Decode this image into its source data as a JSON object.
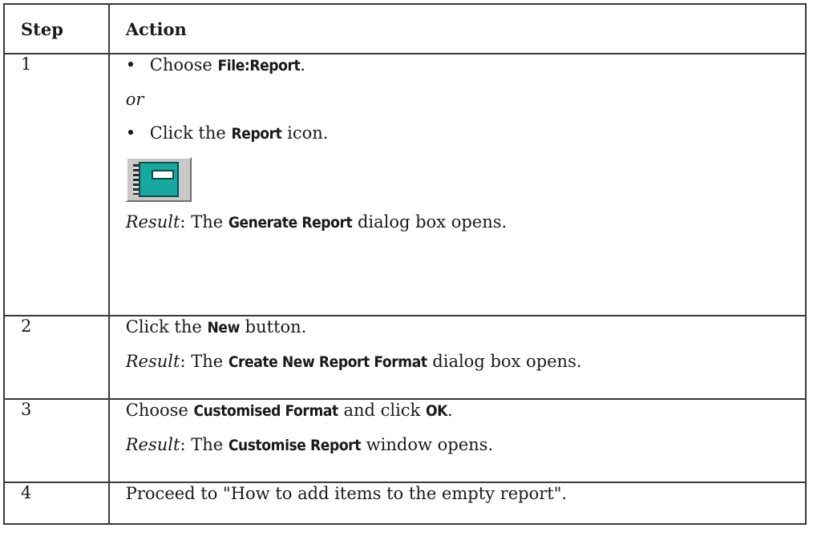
{
  "table": {
    "headers": {
      "step": "Step",
      "action": "Action"
    },
    "rows": [
      {
        "step": "1",
        "line1": {
          "pre": "Choose ",
          "ui": "File:Report",
          "post": "."
        },
        "or": "or",
        "line2": {
          "pre": "Click the ",
          "ui": "Report",
          "post": " icon."
        },
        "icon": "report-icon",
        "result": {
          "label": "Result",
          "pre": ": The ",
          "ui": "Generate Report",
          "post": " dialog box opens."
        }
      },
      {
        "step": "2",
        "line1": {
          "pre": "Click the ",
          "ui": "New",
          "post": " button."
        },
        "result": {
          "label": "Result",
          "pre": ": The ",
          "ui": "Create New Report Format",
          "post": " dialog box opens."
        }
      },
      {
        "step": "3",
        "line1": {
          "pre": "Choose ",
          "ui": "Customised Format",
          "mid": " and click ",
          "ui2": "OK",
          "post": "."
        },
        "result": {
          "label": "Result",
          "pre": ": The ",
          "ui": "Customise Report",
          "post": " window opens."
        }
      },
      {
        "step": "4",
        "line1": {
          "text": "Proceed to \"How to add items to the empty report\"."
        }
      }
    ]
  }
}
